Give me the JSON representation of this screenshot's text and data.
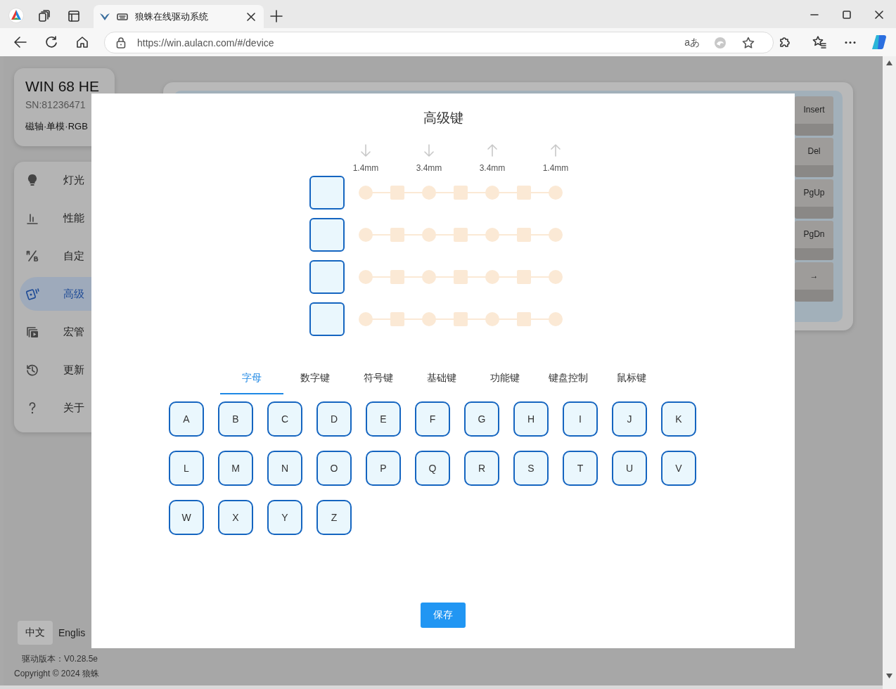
{
  "browser": {
    "tab_title": "狼蛛在线驱动系统",
    "url": "https://win.aulacn.com/#/device",
    "read_aloud": "aあ"
  },
  "device": {
    "name": "WIN 68 HE",
    "serial": "SN:81236471",
    "spec": "磁轴·单模·RGB"
  },
  "nav": [
    {
      "kind": "bulb",
      "label": "灯光",
      "selected": false
    },
    {
      "kind": "bars",
      "label": "性能",
      "selected": false
    },
    {
      "kind": "swap",
      "label": "自定",
      "selected": false
    },
    {
      "kind": "cards",
      "label": "高级",
      "selected": true
    },
    {
      "kind": "macro",
      "label": "宏管",
      "selected": false
    },
    {
      "kind": "history",
      "label": "更新",
      "selected": false
    },
    {
      "kind": "help",
      "label": "关于",
      "selected": false
    }
  ],
  "languages": [
    {
      "label": "中文",
      "selected": true
    },
    {
      "label": "Englis",
      "selected": false
    }
  ],
  "version": "驱动版本：V0.28.5e",
  "copyright": "Copyright © 2024 狼蛛",
  "keyboard_keys": [
    "Insert",
    "Del",
    "PgUp",
    "PgDn",
    "→"
  ],
  "dialog": {
    "title": "高级键",
    "stages": [
      {
        "kind": "down",
        "travel": "1.4mm"
      },
      {
        "kind": "down",
        "travel": "3.4mm"
      },
      {
        "kind": "up",
        "travel": "3.4mm"
      },
      {
        "kind": "up",
        "travel": "1.4mm"
      }
    ],
    "bindings": [
      {
        "assigned": false
      },
      {
        "assigned": false
      },
      {
        "assigned": false
      },
      {
        "assigned": false
      }
    ],
    "tabs": [
      {
        "label": "字母",
        "selected": true
      },
      {
        "label": "数字键",
        "selected": false
      },
      {
        "label": "符号键",
        "selected": false
      },
      {
        "label": "基础键",
        "selected": false
      },
      {
        "label": "功能键",
        "selected": false
      },
      {
        "label": "键盘控制",
        "selected": false
      },
      {
        "label": "鼠标键",
        "selected": false
      }
    ],
    "keys": [
      "A",
      "B",
      "C",
      "D",
      "E",
      "F",
      "G",
      "H",
      "I",
      "J",
      "K",
      "L",
      "M",
      "N",
      "O",
      "P",
      "Q",
      "R",
      "S",
      "T",
      "U",
      "V",
      "W",
      "X",
      "Y",
      "Z"
    ],
    "save_label": "保存"
  }
}
